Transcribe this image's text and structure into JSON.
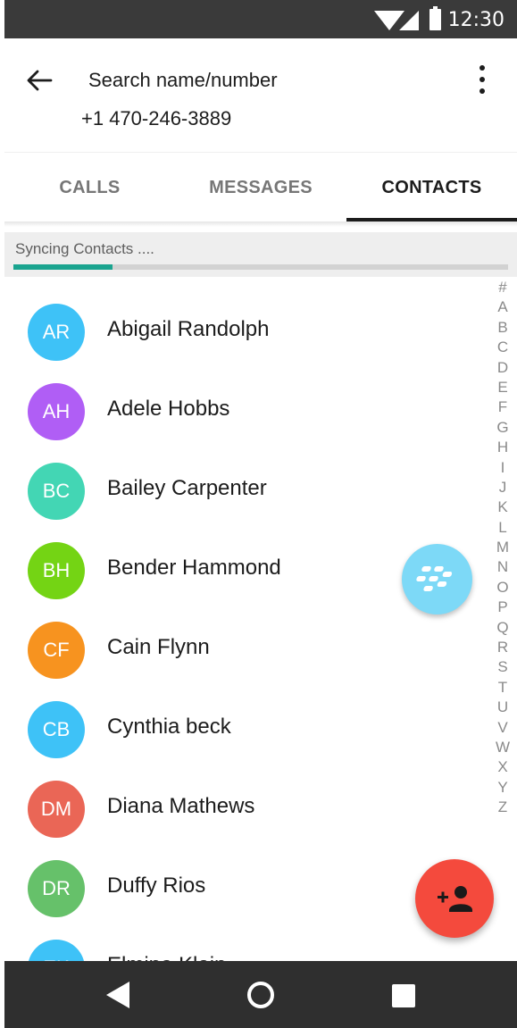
{
  "status_bar": {
    "time": "12:30",
    "icons": [
      "wifi-icon",
      "signal-icon",
      "battery-icon"
    ]
  },
  "header": {
    "back_icon": "arrow-back-icon",
    "search_placeholder": "Search name/number",
    "phone_number": "+1 470-246-3889",
    "menu_icon": "more-vert-icon"
  },
  "tabs": [
    {
      "label": "CALLS",
      "active": false
    },
    {
      "label": "MESSAGES",
      "active": false
    },
    {
      "label": "CONTACTS",
      "active": true
    }
  ],
  "sync": {
    "label": "Syncing Contacts ....",
    "progress": 0.2,
    "color": "#1aa48f"
  },
  "contacts": [
    {
      "initials": "AR",
      "name": "Abigail Randolph",
      "color": "#3ec2f7"
    },
    {
      "initials": "AH",
      "name": "Adele Hobbs",
      "color": "#b05ef5"
    },
    {
      "initials": "BC",
      "name": "Bailey Carpenter",
      "color": "#43d6b4"
    },
    {
      "initials": "BH",
      "name": "Bender Hammond",
      "color": "#74d414"
    },
    {
      "initials": "CF",
      "name": "Cain Flynn",
      "color": "#f7931f"
    },
    {
      "initials": "CB",
      "name": "Cynthia beck",
      "color": "#3ec2f7"
    },
    {
      "initials": "DM",
      "name": "Diana Mathews",
      "color": "#ea6656"
    },
    {
      "initials": "DR",
      "name": "Duffy Rios",
      "color": "#66c16a"
    },
    {
      "initials": "EK",
      "name": "Elmina Klein",
      "color": "#3ec2f7"
    }
  ],
  "alpha_index": [
    "#",
    "A",
    "B",
    "C",
    "D",
    "E",
    "F",
    "G",
    "H",
    "I",
    "J",
    "K",
    "L",
    "M",
    "N",
    "O",
    "P",
    "Q",
    "R",
    "S",
    "T",
    "U",
    "V",
    "W",
    "X",
    "Y",
    "Z"
  ],
  "fabs": {
    "blackberry": "blackberry-icon",
    "add_contact": "add-person-icon"
  },
  "nav_bar": {
    "icons": [
      "nav-back-icon",
      "nav-home-icon",
      "nav-recents-icon"
    ]
  }
}
